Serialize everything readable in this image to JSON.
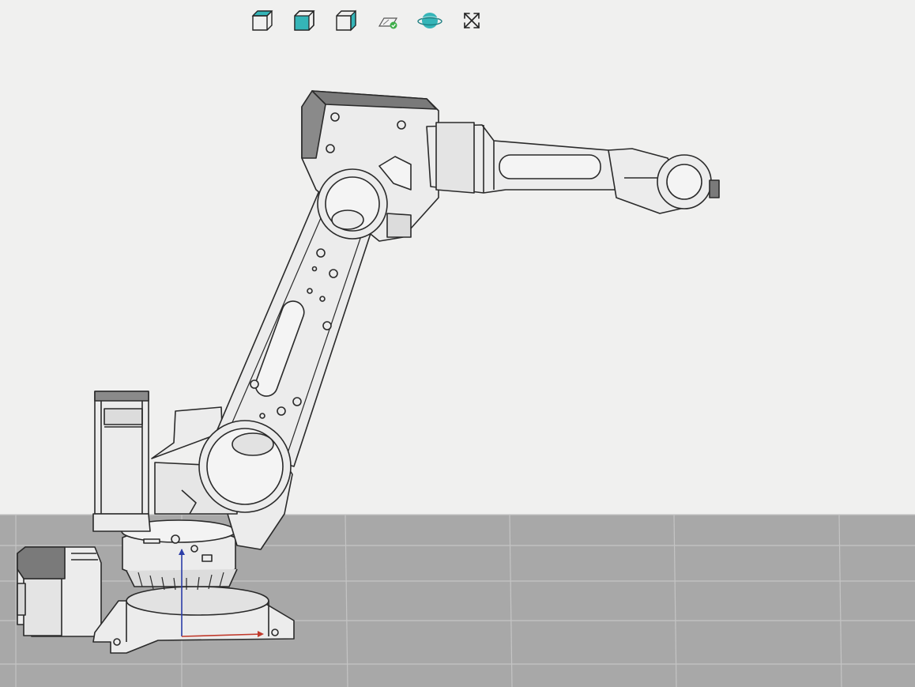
{
  "toolbar": {
    "buttons": [
      {
        "name": "view-cube-top-button",
        "icon": "cube-top-face-icon"
      },
      {
        "name": "view-cube-front-button",
        "icon": "cube-front-face-icon"
      },
      {
        "name": "view-cube-side-button",
        "icon": "cube-side-face-icon"
      },
      {
        "name": "ground-plane-toggle-button",
        "icon": "ground-plane-check-icon"
      },
      {
        "name": "orbit-view-button",
        "icon": "orbit-globe-icon"
      },
      {
        "name": "fullscreen-button",
        "icon": "expand-arrows-icon"
      }
    ]
  },
  "colors": {
    "background": "#f0f0ef",
    "floor": "#a8a8a8",
    "grid_line": "#c4c4c4",
    "accent_teal": "#35b5b8",
    "model_fill": "#ececec",
    "model_stroke": "#2a2a2a",
    "axis_x": "#c0392b",
    "axis_y": "#2c3ea8"
  }
}
